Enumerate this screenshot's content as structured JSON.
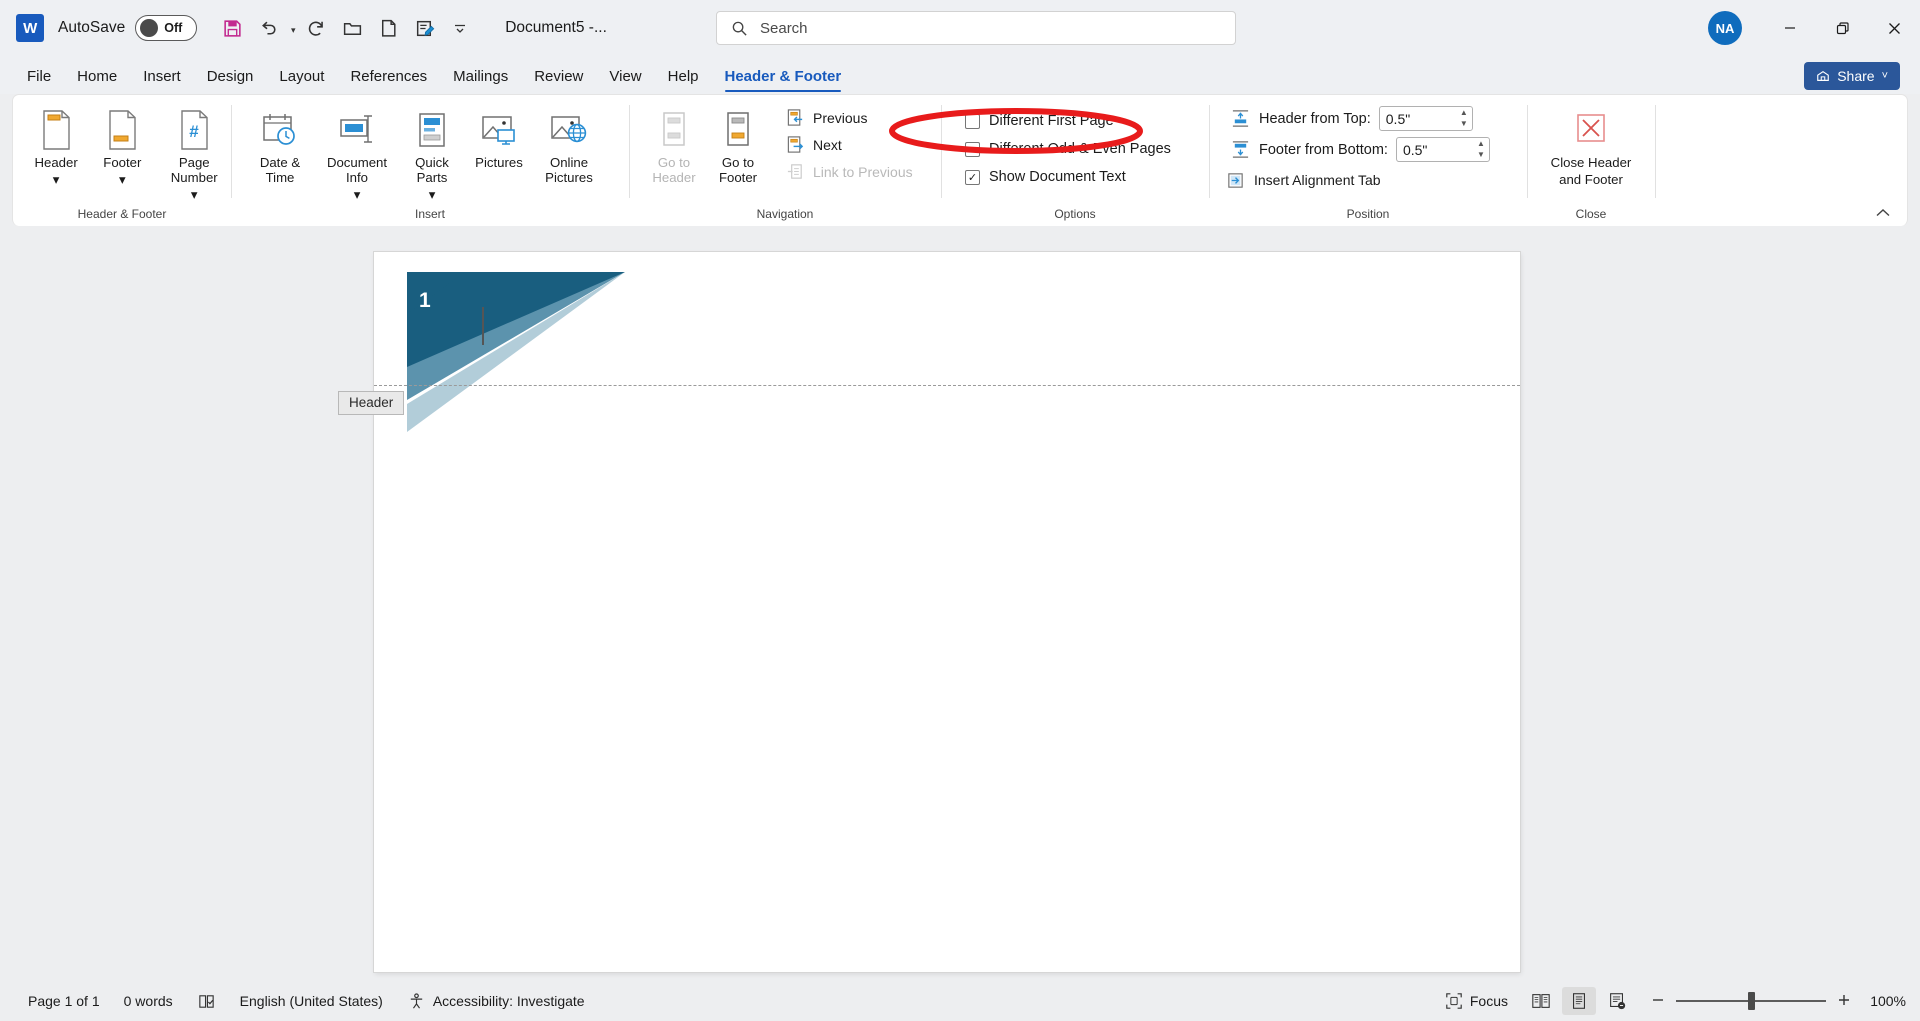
{
  "titlebar": {
    "app_logo": "word-logo",
    "autosave_label": "AutoSave",
    "autosave_state": "Off",
    "document_title": "Document5 -...",
    "quick_access": [
      {
        "name": "save-icon",
        "label": "Save"
      },
      {
        "name": "undo-icon",
        "label": "Undo"
      },
      {
        "name": "redo-icon",
        "label": "Redo"
      },
      {
        "name": "open-folder-icon",
        "label": "Open"
      },
      {
        "name": "new-document-icon",
        "label": "New"
      },
      {
        "name": "editor-icon",
        "label": "Editor"
      },
      {
        "name": "customize-quick-access-toolbar-icon",
        "label": "Customize Quick Access Toolbar"
      }
    ],
    "account_initials": "NA",
    "window_controls": [
      "minimize",
      "restore",
      "close"
    ]
  },
  "search": {
    "placeholder": "Search",
    "icon": "search-icon"
  },
  "tabs": [
    {
      "label": "File",
      "active": false
    },
    {
      "label": "Home",
      "active": false
    },
    {
      "label": "Insert",
      "active": false
    },
    {
      "label": "Design",
      "active": false
    },
    {
      "label": "Layout",
      "active": false
    },
    {
      "label": "References",
      "active": false
    },
    {
      "label": "Mailings",
      "active": false
    },
    {
      "label": "Review",
      "active": false
    },
    {
      "label": "View",
      "active": false
    },
    {
      "label": "Help",
      "active": false
    },
    {
      "label": "Header & Footer",
      "active": true
    }
  ],
  "share": {
    "label": "Share",
    "icon": "share-icon",
    "caret": "˅",
    "color": "#2b579a"
  },
  "ribbon": {
    "collapse_icon": "chevron-up-icon",
    "groups": [
      {
        "name": "header-and-footer",
        "label": "Header & Footer",
        "buttons": [
          {
            "name": "header-button",
            "label": "Header",
            "has_caret": true,
            "icon": "header-page-icon"
          },
          {
            "name": "footer-button",
            "label": "Footer",
            "has_caret": true,
            "icon": "footer-page-icon"
          },
          {
            "name": "page-number-button",
            "label": "Page Number",
            "has_caret": true,
            "icon": "page-number-icon"
          }
        ]
      },
      {
        "name": "insert",
        "label": "Insert",
        "buttons": [
          {
            "name": "date-and-time-button",
            "label": "Date & Time",
            "has_caret": false,
            "icon": "calendar-clock-icon"
          },
          {
            "name": "document-info-button",
            "label": "Document Info",
            "has_caret": true,
            "icon": "document-info-icon"
          },
          {
            "name": "quick-parts-button",
            "label": "Quick Parts",
            "has_caret": true,
            "icon": "quick-parts-icon"
          },
          {
            "name": "pictures-button",
            "label": "Pictures",
            "has_caret": false,
            "icon": "pictures-icon"
          },
          {
            "name": "online-pictures-button",
            "label": "Online Pictures",
            "has_caret": false,
            "icon": "online-pictures-icon"
          }
        ]
      },
      {
        "name": "navigation",
        "label": "Navigation",
        "buttons": [
          {
            "name": "go-to-header-button",
            "label": "Go to Header",
            "disabled": true,
            "icon": "go-to-header-icon"
          },
          {
            "name": "go-to-footer-button",
            "label": "Go to Footer",
            "disabled": false,
            "icon": "go-to-footer-icon"
          }
        ],
        "small_items": [
          {
            "name": "previous-button",
            "label": "Previous",
            "disabled": false,
            "icon": "previous-section-icon"
          },
          {
            "name": "next-button",
            "label": "Next",
            "disabled": false,
            "icon": "next-section-icon"
          },
          {
            "name": "link-to-previous-button",
            "label": "Link to Previous",
            "disabled": true,
            "icon": "link-to-previous-icon"
          }
        ]
      },
      {
        "name": "options",
        "label": "Options",
        "checkboxes": [
          {
            "name": "different-first-page-checkbox",
            "label": "Different First Page",
            "checked": false,
            "highlighted": true
          },
          {
            "name": "different-odd-and-even-pages-checkbox",
            "label": "Different Odd & Even Pages",
            "checked": false,
            "highlighted": false
          },
          {
            "name": "show-document-text-checkbox",
            "label": "Show Document Text",
            "checked": true,
            "highlighted": false
          }
        ]
      },
      {
        "name": "position",
        "label": "Position",
        "fields": [
          {
            "name": "header-from-top-field",
            "label": "Header from Top:",
            "value": "0.5\"",
            "icon": "header-from-top-icon"
          },
          {
            "name": "footer-from-bottom-field",
            "label": "Footer from Bottom:",
            "value": "0.5\"",
            "icon": "footer-from-bottom-icon"
          }
        ],
        "command": {
          "name": "insert-alignment-tab-button",
          "label": "Insert Alignment Tab",
          "icon": "alignment-tab-icon"
        }
      },
      {
        "name": "close",
        "label": "Close",
        "buttons": [
          {
            "name": "close-header-and-footer-button",
            "label_line1": "Close Header",
            "label_line2": "and Footer",
            "icon": "close-x-icon"
          }
        ]
      }
    ]
  },
  "document": {
    "page_number_text": "1",
    "header_tag_label": "Header",
    "art_colors": {
      "dark_teal": "#195e7f",
      "mid_blue": "#4a87a4",
      "light_blue": "#b2cdd9",
      "pale_blue": "#5c93ad"
    }
  },
  "annotation": {
    "shape": "ellipse",
    "color": "#e81b1b",
    "target": "Different First Page"
  },
  "statusbar": {
    "page_indicator": "Page 1 of 1",
    "word_count": "0 words",
    "proofing_icon": "proofing-errors-icon",
    "language": "English (United States)",
    "accessibility_icon": "accessibility-icon",
    "accessibility": "Accessibility: Investigate",
    "focus_label": "Focus",
    "focus_icon": "focus-mode-icon",
    "views": [
      {
        "name": "read-mode-view-button",
        "icon": "read-mode-icon",
        "selected": false
      },
      {
        "name": "print-layout-view-button",
        "icon": "print-layout-icon",
        "selected": true
      },
      {
        "name": "web-layout-view-button",
        "icon": "web-layout-icon",
        "selected": false
      }
    ],
    "zoom_out_icon": "minus-icon",
    "zoom_in_icon": "plus-icon",
    "zoom_level": "100%"
  }
}
